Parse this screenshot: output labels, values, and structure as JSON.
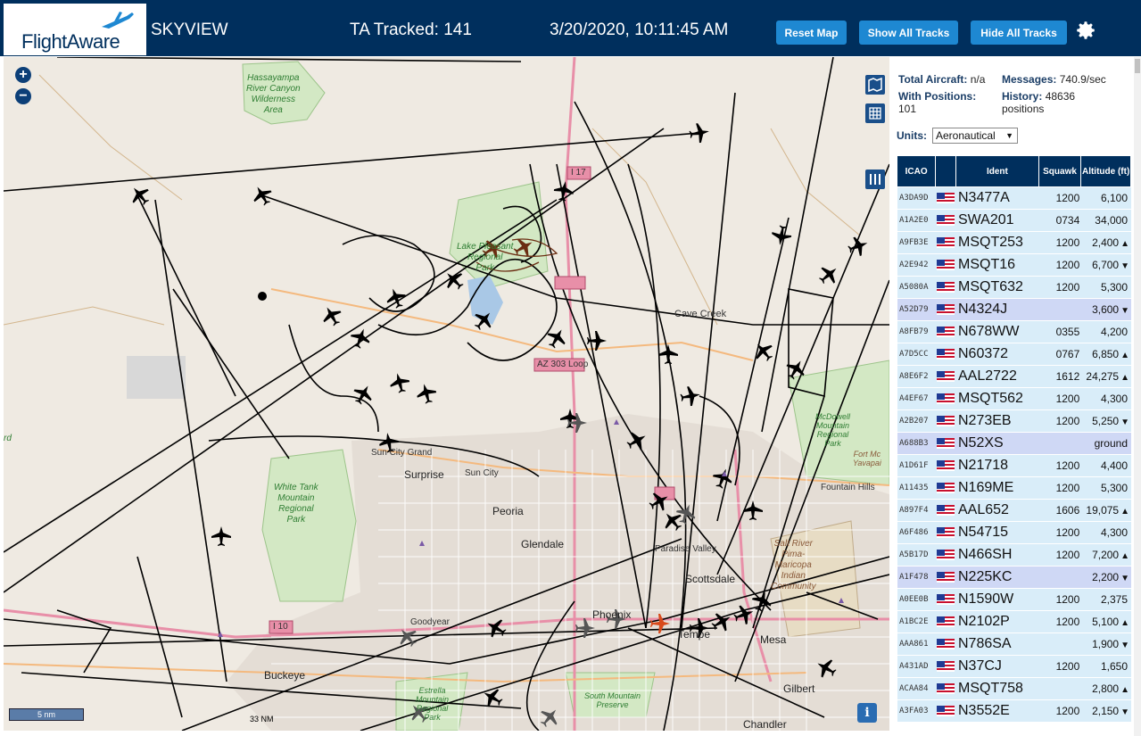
{
  "header": {
    "logo_text": "FlightAware",
    "app_name": "SKYVIEW",
    "tracked": "TA Tracked: 141",
    "clock": "3/20/2020, 10:11:45 AM",
    "buttons": {
      "reset": "Reset Map",
      "show": "Show All Tracks",
      "hide": "Hide All Tracks"
    }
  },
  "map": {
    "zoom_in": "+",
    "zoom_out": "−",
    "scale": "5 nm",
    "scale_nm": "33 NM",
    "info": "i",
    "labels": {
      "hassayampa": "Hassayampa\nRiver Canyon\nWilderness\nArea",
      "lake_pleasant": "Lake Pleasant\nRegional\nPark",
      "cave_creek": "Cave Creek",
      "az303": "AZ 303 Loop",
      "i17": "I 17",
      "i10": "I 10",
      "sun_city_grand": "Sun City Grand",
      "surprise": "Surprise",
      "sun_city": "Sun City",
      "white_tank": "White Tank\nMountain\nRegional\nPark",
      "peoria": "Peoria",
      "glendale": "Glendale",
      "paradise_valley": "Paradise Valley",
      "scottsdale": "Scottsdale",
      "phoenix": "Phoenix",
      "tempe": "Tempe",
      "mesa": "Mesa",
      "gilbert": "Gilbert",
      "chandler": "Chandler",
      "goodyear": "Goodyear",
      "buckeye": "Buckeye",
      "estrella": "Estrella\nMountain\nRegional\nPark",
      "south_mountain": "South Mountain\nPreserve",
      "salt_river": "Salt River\nPima-\nMaricopa\nIndian\nCommunity",
      "mcdowell": "McDowell\nMountain\nRegional\nPark",
      "fort_mc": "Fort Mc\nYavapai",
      "fountain_hills": "Fountain Hills",
      "rd": "rd"
    }
  },
  "stats": {
    "total_label": "Total Aircraft:",
    "total_value": "n/a",
    "messages_label": "Messages:",
    "messages_value": "740.9/sec",
    "positions_label": "With Positions:",
    "positions_value": "101",
    "history_label": "History:",
    "history_value": "48636",
    "history_suffix": "positions"
  },
  "units": {
    "label": "Units:",
    "selected": "Aeronautical"
  },
  "table": {
    "headers": [
      "ICAO",
      "",
      "Ident",
      "Squawk",
      "Altitude (ft)"
    ],
    "rows": [
      {
        "icao": "A3DA9D",
        "ident": "N3477A",
        "squawk": "1200",
        "alt": "6,100",
        "trend": "",
        "sel": false
      },
      {
        "icao": "A1A2E0",
        "ident": "SWA201",
        "squawk": "0734",
        "alt": "34,000",
        "trend": "",
        "sel": false
      },
      {
        "icao": "A9FB3E",
        "ident": "MSQT253",
        "squawk": "1200",
        "alt": "2,400",
        "trend": "▲",
        "sel": false
      },
      {
        "icao": "A2E942",
        "ident": "MSQT16",
        "squawk": "1200",
        "alt": "6,700",
        "trend": "▼",
        "sel": false
      },
      {
        "icao": "A5080A",
        "ident": "MSQT632",
        "squawk": "1200",
        "alt": "5,300",
        "trend": "",
        "sel": false
      },
      {
        "icao": "A52D79",
        "ident": "N4324J",
        "squawk": "",
        "alt": "3,600",
        "trend": "▼",
        "sel": true
      },
      {
        "icao": "A8FB79",
        "ident": "N678WW",
        "squawk": "0355",
        "alt": "4,200",
        "trend": "",
        "sel": false
      },
      {
        "icao": "A7D5CC",
        "ident": "N60372",
        "squawk": "0767",
        "alt": "6,850",
        "trend": "▲",
        "sel": false
      },
      {
        "icao": "A8E6F2",
        "ident": "AAL2722",
        "squawk": "1612",
        "alt": "24,275",
        "trend": "▲",
        "sel": false
      },
      {
        "icao": "A4EF67",
        "ident": "MSQT562",
        "squawk": "1200",
        "alt": "4,300",
        "trend": "",
        "sel": false
      },
      {
        "icao": "A2B207",
        "ident": "N273EB",
        "squawk": "1200",
        "alt": "5,250",
        "trend": "▼",
        "sel": false
      },
      {
        "icao": "A688B3",
        "ident": "N52XS",
        "squawk": "",
        "alt": "ground",
        "trend": "",
        "sel": true
      },
      {
        "icao": "A1D61F",
        "ident": "N21718",
        "squawk": "1200",
        "alt": "4,400",
        "trend": "",
        "sel": false
      },
      {
        "icao": "A11435",
        "ident": "N169ME",
        "squawk": "1200",
        "alt": "5,300",
        "trend": "",
        "sel": false
      },
      {
        "icao": "A897F4",
        "ident": "AAL652",
        "squawk": "1606",
        "alt": "19,075",
        "trend": "▲",
        "sel": false
      },
      {
        "icao": "A6F486",
        "ident": "N54715",
        "squawk": "1200",
        "alt": "4,300",
        "trend": "",
        "sel": false
      },
      {
        "icao": "A5B17D",
        "ident": "N466SH",
        "squawk": "1200",
        "alt": "7,200",
        "trend": "▲",
        "sel": false
      },
      {
        "icao": "A1F478",
        "ident": "N225KC",
        "squawk": "",
        "alt": "2,200",
        "trend": "▼",
        "sel": true
      },
      {
        "icao": "A0EE0B",
        "ident": "N1590W",
        "squawk": "1200",
        "alt": "2,375",
        "trend": "",
        "sel": false
      },
      {
        "icao": "A1BC2E",
        "ident": "N2102P",
        "squawk": "1200",
        "alt": "5,100",
        "trend": "▲",
        "sel": false
      },
      {
        "icao": "AAA861",
        "ident": "N786SA",
        "squawk": "",
        "alt": "1,900",
        "trend": "▼",
        "sel": false
      },
      {
        "icao": "A431AD",
        "ident": "N37CJ",
        "squawk": "1200",
        "alt": "1,650",
        "trend": "",
        "sel": false
      },
      {
        "icao": "ACAA84",
        "ident": "MSQT758",
        "squawk": "",
        "alt": "2,800",
        "trend": "▲",
        "sel": false
      },
      {
        "icao": "A3FA03",
        "ident": "N3552E",
        "squawk": "1200",
        "alt": "2,150",
        "trend": "▼",
        "sel": false
      }
    ]
  },
  "colors": {
    "header_bg": "#002f5d",
    "button": "#1e88d2",
    "row_bg": "#d9edf9",
    "row_selected": "#cfd8f5"
  }
}
